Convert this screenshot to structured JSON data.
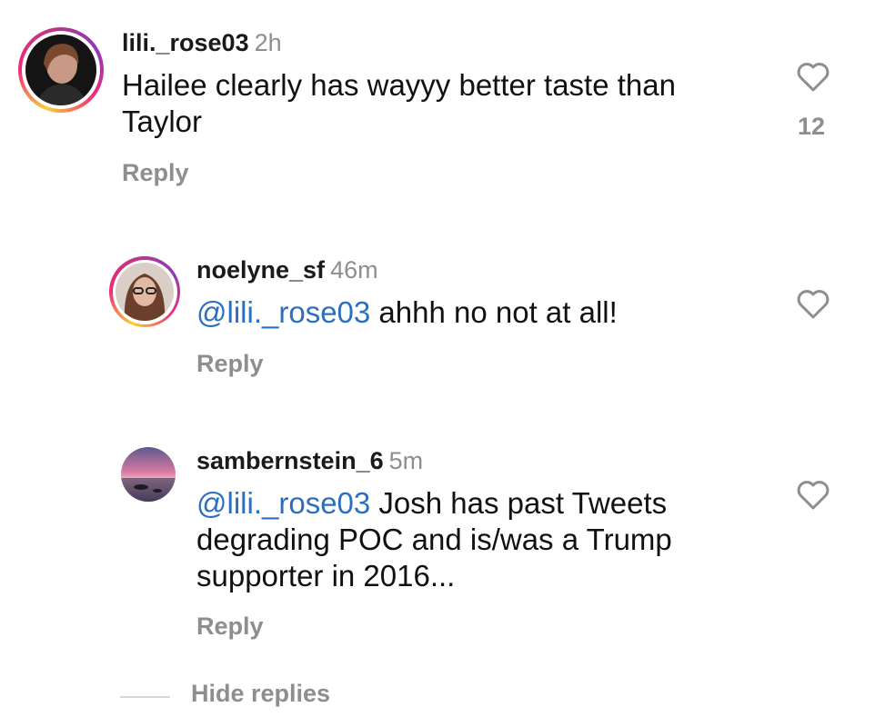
{
  "comments": [
    {
      "username": "lili._rose03",
      "time": "2h",
      "mention": "",
      "text": "Hailee clearly has wayyy better taste than Taylor",
      "reply_label": "Reply",
      "like_count": "12",
      "avatar": "profile-photo-woman-dark-background",
      "story_ring": true
    },
    {
      "username": "noelyne_sf",
      "time": "46m",
      "mention": "@lili._rose03",
      "text": "ahhh no not at all!",
      "reply_label": "Reply",
      "like_count": "",
      "avatar": "profile-photo-woman-glasses",
      "story_ring": true
    },
    {
      "username": "sambernstein_6",
      "time": "5m",
      "mention": "@lili._rose03",
      "text": "Josh has past Tweets degrading POC and is/was a Trump supporter in 2016...",
      "reply_label": "Reply",
      "like_count": "",
      "avatar": "profile-photo-sunset-lake",
      "story_ring": false
    }
  ],
  "hide_replies_label": "Hide replies",
  "colors": {
    "mention": "#2c6fbf",
    "muted": "#8e8e8e",
    "ring_gradient": [
      "#f9ce34",
      "#ee2a7b",
      "#8a3ab9"
    ]
  },
  "icons": {
    "like": "heart-outline-icon"
  }
}
